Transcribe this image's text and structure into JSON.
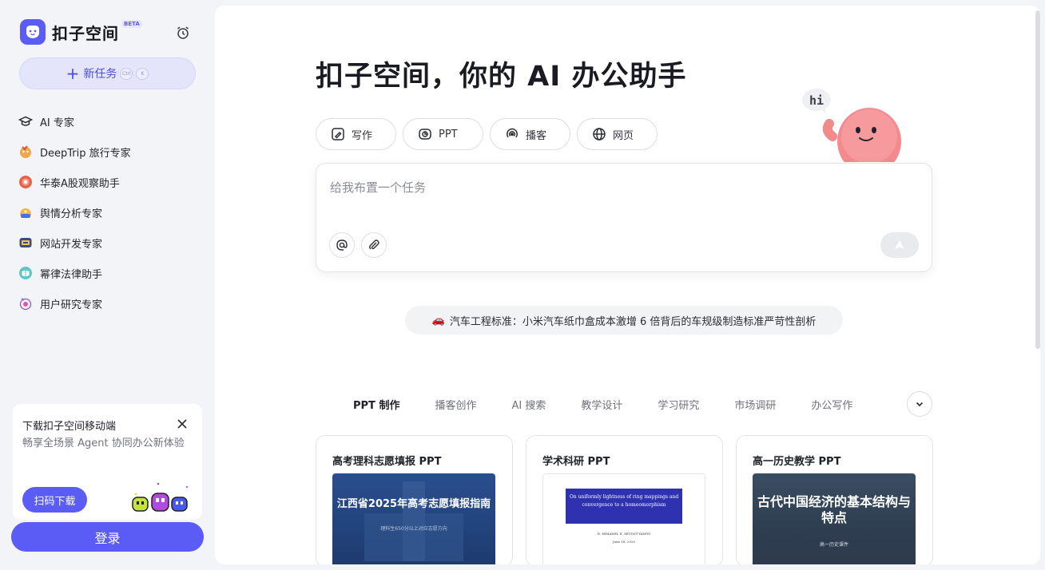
{
  "brand": {
    "name": "扣子空间",
    "badge": "BETA"
  },
  "sidebar": {
    "new_task": {
      "label": "新任务",
      "shortcut_1": "Ctrl",
      "shortcut_2": "K"
    },
    "items": [
      {
        "label": "AI 专家",
        "icon": "graduation-cap-icon"
      },
      {
        "label": "DeepTrip 旅行专家",
        "icon": "travel-agent-icon"
      },
      {
        "label": "华泰A股观察助手",
        "icon": "stock-agent-icon"
      },
      {
        "label": "舆情分析专家",
        "icon": "sentiment-agent-icon"
      },
      {
        "label": "网站开发专家",
        "icon": "web-dev-agent-icon"
      },
      {
        "label": "幂律法律助手",
        "icon": "law-agent-icon"
      },
      {
        "label": "用户研究专家",
        "icon": "user-research-agent-icon"
      }
    ],
    "download_card": {
      "title": "下载扣子空间移动端",
      "description": "畅享全场景 Agent 协同办公新体验",
      "button": "扫码下载"
    },
    "login_button": "登录"
  },
  "main": {
    "headline": "扣子空间，你的 AI 办公助手",
    "mascot_bubble": "hi",
    "tools": [
      {
        "label": "写作",
        "icon": "write-icon"
      },
      {
        "label": "PPT",
        "icon": "ppt-icon"
      },
      {
        "label": "播客",
        "icon": "podcast-icon"
      },
      {
        "label": "网页",
        "icon": "globe-icon"
      }
    ],
    "input": {
      "placeholder": "给我布置一个任务"
    },
    "hint": {
      "icon": "🚗",
      "text": "汽车工程标准：小米汽车纸巾盒成本激增 6 倍背后的车规级制造标准严苛性剖析"
    },
    "categories": [
      "PPT 制作",
      "播客创作",
      "AI 搜索",
      "教学设计",
      "学习研究",
      "市场调研",
      "办公写作"
    ],
    "active_category": "PPT 制作",
    "cards": [
      {
        "title": "高考理科志愿填报 PPT",
        "thumb_title": "江西省2025年高考志愿填报指南",
        "thumb_sub": "理科生650分以上对应志愿方向"
      },
      {
        "title": "学术科研 PPT",
        "thumb_title": "On uniformly lightness of ring mappings and convergence to a homeomorphism",
        "thumb_author": "D. HIMASHI, E. SEVOST'YANOV",
        "thumb_date": "June 18, 2025"
      },
      {
        "title": "高一历史教学 PPT",
        "thumb_title": "古代中国经济的基本结构与特点",
        "thumb_sub": "高一历史课件"
      }
    ]
  },
  "colors": {
    "accent": "#5b5bf5",
    "accent_light": "#e4e5fb",
    "background": "#f3f4f7"
  }
}
